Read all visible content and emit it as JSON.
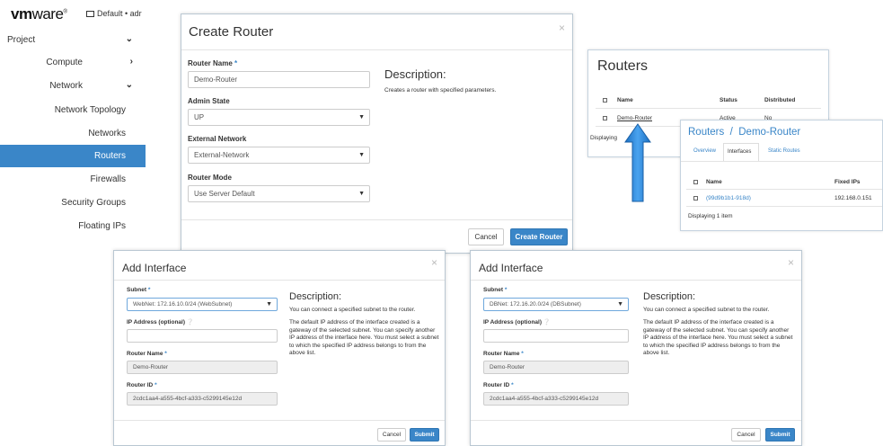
{
  "header": {
    "logo_vm": "vm",
    "logo_ware": "ware",
    "logo_reg": "®",
    "project_selector": "Default • adr"
  },
  "sidebar": {
    "items": [
      {
        "label": "Project",
        "chevron": "chevron-down"
      },
      {
        "label": "Compute",
        "chevron": "chevron-right"
      },
      {
        "label": "Network",
        "chevron": "chevron-down"
      },
      {
        "label": "Network Topology"
      },
      {
        "label": "Networks"
      },
      {
        "label": "Routers",
        "active": true
      },
      {
        "label": "Firewalls"
      },
      {
        "label": "Security Groups"
      },
      {
        "label": "Floating IPs"
      }
    ]
  },
  "create_router": {
    "title": "Create Router",
    "close": "×",
    "router_name_label": "Router Name",
    "router_name_value": "Demo-Router",
    "admin_state_label": "Admin State",
    "admin_state_value": "UP",
    "external_network_label": "External Network",
    "external_network_value": "External-Network",
    "router_mode_label": "Router Mode",
    "router_mode_value": "Use Server Default",
    "desc_title": "Description:",
    "desc_text": "Creates a router with specified parameters.",
    "cancel": "Cancel",
    "submit": "Create Router"
  },
  "routers_list": {
    "title": "Routers",
    "col_name": "Name",
    "col_status": "Status",
    "col_distributed": "Distributed",
    "row_name": "Demo-Router",
    "row_status": "Active",
    "row_distributed": "No",
    "footer": "Displaying"
  },
  "router_detail": {
    "breadcrumb": "Routers  /  Demo-Router",
    "tabs": [
      "Overview",
      "Interfaces",
      "Static Routes"
    ],
    "col_name": "Name",
    "col_fixed_ips": "Fixed IPs",
    "row_name": "(99d9b1b1-918d)",
    "row_ip": "192.168.0.151",
    "footer": "Displaying 1 item"
  },
  "add_interface_web": {
    "title": "Add Interface",
    "close": "×",
    "subnet_label": "Subnet",
    "subnet_value": "WebNet: 172.16.10.0/24 (WebSubnet)",
    "ip_label": "IP Address (optional)",
    "router_name_label": "Router Name",
    "router_name_value": "Demo-Router",
    "router_id_label": "Router ID",
    "router_id_value": "2cdc1aa4-a555-4bcf-a333-c5299145e12d",
    "desc_title": "Description:",
    "desc_p1": "You can connect a specified subnet to the router.",
    "desc_p2": "The default IP address of the interface created is a gateway of the selected subnet. You can specify another IP address of the interface here. You must select a subnet to which the specified IP address belongs to from the above list.",
    "cancel": "Cancel",
    "submit": "Submit"
  },
  "add_interface_db": {
    "title": "Add Interface",
    "close": "×",
    "subnet_label": "Subnet",
    "subnet_value": "DBNet: 172.16.20.0/24 (DBSubnet)",
    "ip_label": "IP Address (optional)",
    "router_name_label": "Router Name",
    "router_name_value": "Demo-Router",
    "router_id_label": "Router ID",
    "router_id_value": "2cdc1aa4-a555-4bcf-a333-c5299145e12d",
    "desc_title": "Description:",
    "desc_p1": "You can connect a specified subnet to the router.",
    "desc_p2": "The default IP address of the interface created is a gateway of the selected subnet. You can specify another IP address of the interface here. You must select a subnet to which the specified IP address belongs to from the above list.",
    "cancel": "Cancel",
    "submit": "Submit"
  },
  "colors": {
    "accent": "#3a86c8",
    "arrow": "#2f86d6"
  }
}
